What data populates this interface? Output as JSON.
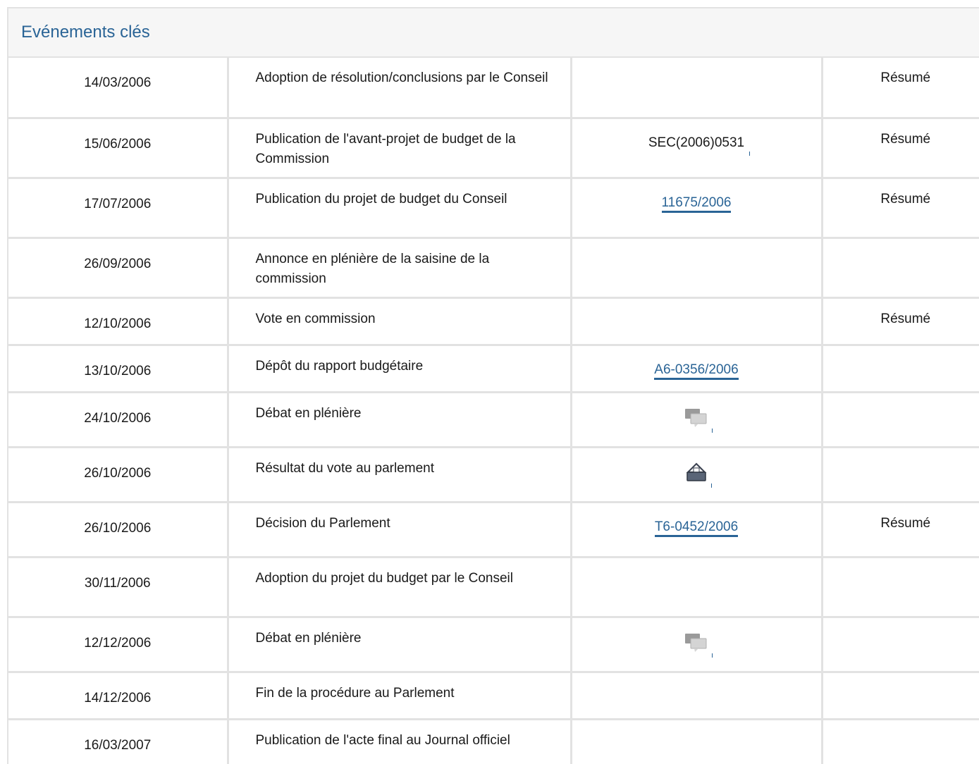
{
  "header": {
    "title": "Evénements clés"
  },
  "rows": [
    {
      "date": "14/03/2006",
      "event": "Adoption de résolution/conclusions par le Conseil",
      "doc": "",
      "summary": "Résumé"
    },
    {
      "date": "15/06/2006",
      "event": "Publication de l'avant-projet de budget de la Commission",
      "doc": "SEC(2006)0531",
      "summary": "Résumé"
    },
    {
      "date": "17/07/2006",
      "event": "Publication du projet de budget du Conseil",
      "doc": "11675/2006",
      "summary": "Résumé"
    },
    {
      "date": "26/09/2006",
      "event": "Annonce en plénière de la saisine de la commission",
      "doc": "",
      "summary": ""
    },
    {
      "date": "12/10/2006",
      "event": "Vote en commission",
      "doc": "",
      "summary": "Résumé"
    },
    {
      "date": "13/10/2006",
      "event": "Dépôt du rapport budgétaire",
      "doc": "A6-0356/2006",
      "summary": ""
    },
    {
      "date": "24/10/2006",
      "event": "Débat en plénière",
      "doc": "",
      "summary": ""
    },
    {
      "date": "26/10/2006",
      "event": "Résultat du vote au parlement",
      "doc": "",
      "summary": ""
    },
    {
      "date": "26/10/2006",
      "event": "Décision du Parlement",
      "doc": "T6-0452/2006",
      "summary": "Résumé"
    },
    {
      "date": "30/11/2006",
      "event": "Adoption du projet du budget par le Conseil",
      "doc": "",
      "summary": ""
    },
    {
      "date": "12/12/2006",
      "event": "Débat en plénière",
      "doc": "",
      "summary": ""
    },
    {
      "date": "14/12/2006",
      "event": "Fin de la procédure au Parlement",
      "doc": "",
      "summary": ""
    },
    {
      "date": "16/03/2007",
      "event": "Publication de l'acte final au Journal officiel",
      "doc": "",
      "summary": ""
    }
  ],
  "icons": {
    "debate": "speech-bubbles-icon",
    "vote": "ballot-box-icon"
  },
  "colors": {
    "link": "#2a6496",
    "border": "#e2e2e2"
  }
}
